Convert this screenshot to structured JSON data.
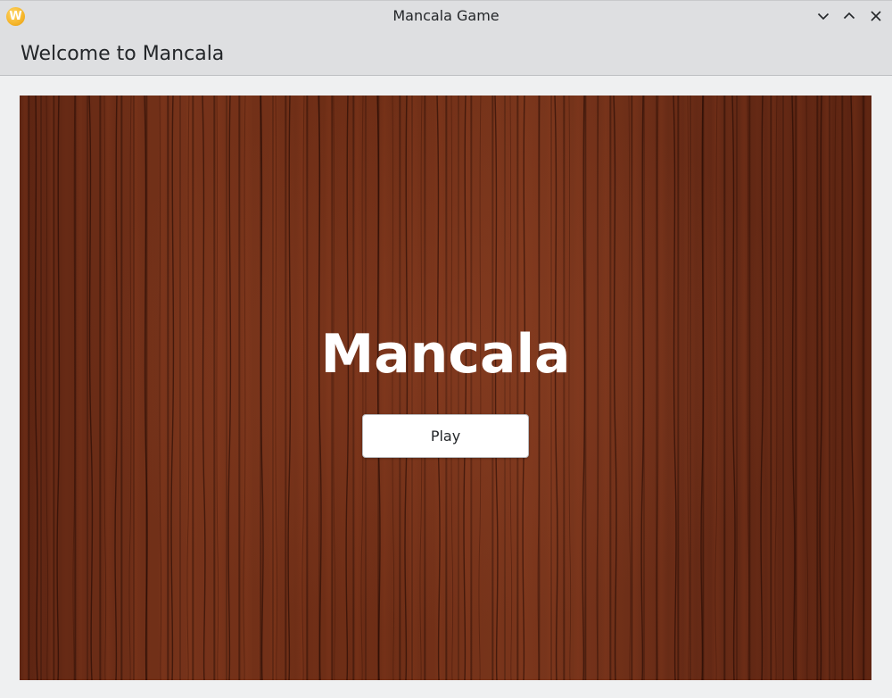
{
  "window": {
    "title": "Mancala Game",
    "app_icon": "w-app-icon",
    "controls": {
      "minimize": "chevron-down-icon",
      "maximize": "chevron-up-icon",
      "close": "close-icon"
    }
  },
  "header": {
    "heading": "Welcome to Mancala"
  },
  "main": {
    "game_title": "Mancala",
    "play_label": "Play"
  },
  "colors": {
    "titlebar": "#dedfe1",
    "background": "#eff0f1",
    "wood": "#6a2c16",
    "title_text": "#ffffff"
  }
}
